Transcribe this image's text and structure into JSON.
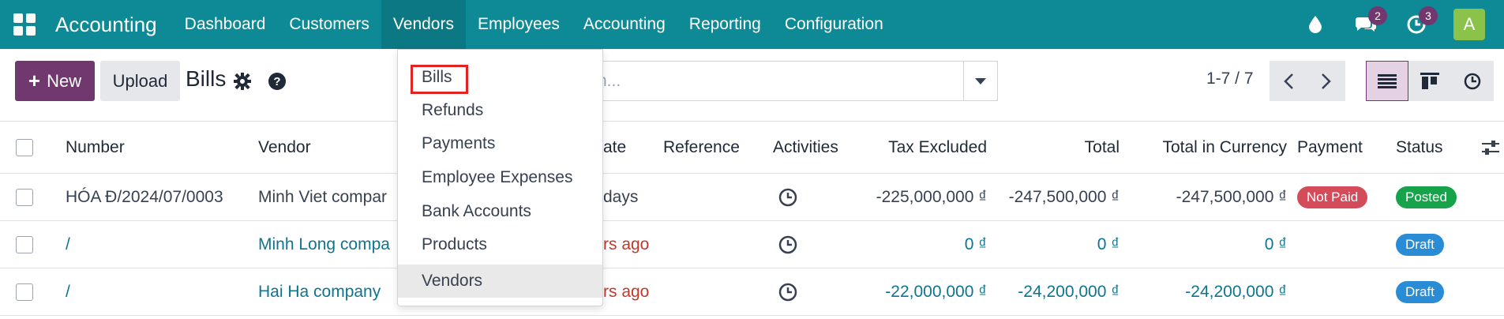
{
  "app": {
    "name": "Accounting"
  },
  "nav": [
    {
      "label": "Dashboard"
    },
    {
      "label": "Customers"
    },
    {
      "label": "Vendors"
    },
    {
      "label": "Employees"
    },
    {
      "label": "Accounting"
    },
    {
      "label": "Reporting"
    },
    {
      "label": "Configuration"
    }
  ],
  "systray": {
    "messages_count": "2",
    "activities_count": "3",
    "avatar_letter": "A"
  },
  "control": {
    "new_label": "New",
    "upload_label": "Upload",
    "title": "Bills",
    "search_placeholder": "n...",
    "pager": "1-7 / 7"
  },
  "dropdown": {
    "items": [
      "Bills",
      "Refunds",
      "Payments",
      "Employee Expenses",
      "Bank Accounts",
      "Products",
      "Vendors"
    ]
  },
  "table": {
    "headers": {
      "number": "Number",
      "vendor": "Vendor",
      "date": "ate",
      "reference": "Reference",
      "activities": "Activities",
      "tax_excluded": "Tax Excluded",
      "total": "Total",
      "total_currency": "Total in Currency",
      "payment": "Payment",
      "status": "Status"
    },
    "rows": [
      {
        "number": "HÓA Đ/2024/07/0003",
        "vendor": "Minh Viet compar",
        "date": "days",
        "tax_excluded": "-225,000,000 ₫",
        "total": "-247,500,000 ₫",
        "total_currency": "-247,500,000 ₫",
        "payment": "Not Paid",
        "status": "Posted"
      },
      {
        "number": "/",
        "vendor": "Minh Long compa",
        "date": "rs ago",
        "tax_excluded": "0 ₫",
        "total": "0 ₫",
        "total_currency": "0 ₫",
        "payment": "",
        "status": "Draft"
      },
      {
        "number": "/",
        "vendor": "Hai Ha company",
        "date": "rs ago",
        "tax_excluded": "-22,000,000 ₫",
        "total": "-24,200,000 ₫",
        "total_currency": "-24,200,000 ₫",
        "payment": "",
        "status": "Draft"
      }
    ]
  }
}
